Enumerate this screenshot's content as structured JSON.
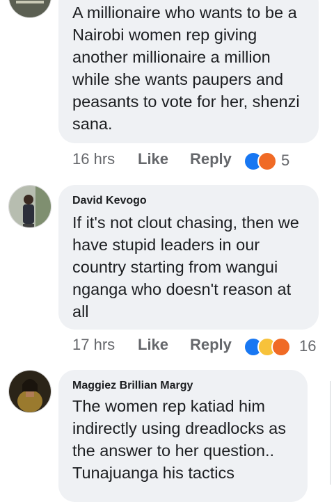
{
  "comments": [
    {
      "author": "",
      "lines": [
        "A millionaire who wants to be a",
        "Nairobi women rep giving",
        "another millionaire a million",
        "while she wants paupers and",
        "peasants to vote for her, shenzi",
        "sana."
      ],
      "time": "16 hrs",
      "like_label": "Like",
      "reply_label": "Reply",
      "reactions": [
        "like-reaction",
        "angry-reaction"
      ],
      "reaction_count": "5"
    },
    {
      "author": "David Kevogo",
      "lines": [
        "If it's not clout chasing, then we",
        "have stupid leaders in our",
        "country starting from wangui",
        "nganga who doesn't reason at",
        "all"
      ],
      "time": "17 hrs",
      "like_label": "Like",
      "reply_label": "Reply",
      "reactions": [
        "like-reaction",
        "haha-reaction",
        "angry-reaction"
      ],
      "reaction_count": "16"
    },
    {
      "author": "Maggiez Brillian Margy",
      "lines": [
        "The women rep katiad him",
        "indirectly using dreadlocks as",
        "the answer to her question..",
        "Tunajuanga his tactics"
      ]
    }
  ],
  "colors": {
    "bubble": "#eff1f4",
    "meta_text": "#65676b",
    "like_blue": "#1877f2",
    "angry_orange": "#f06a25",
    "haha_yellow": "#f7c23a"
  }
}
